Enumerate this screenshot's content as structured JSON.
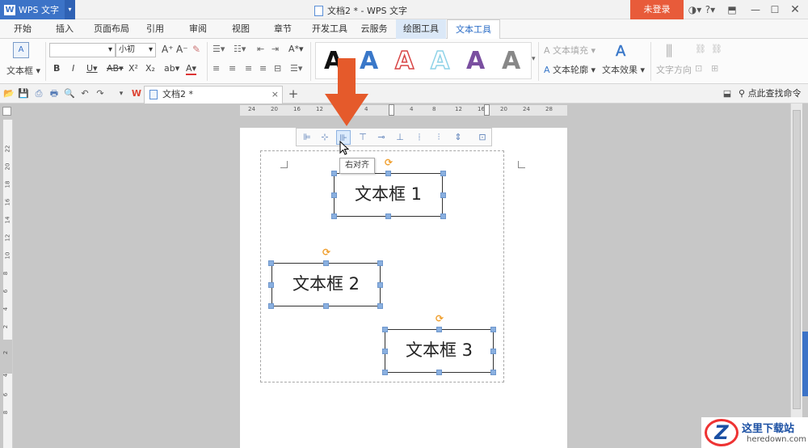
{
  "app": {
    "name": "WPS 文字",
    "window_title": "文档2 * - WPS 文字",
    "login": "未登录"
  },
  "titlebar_icons": [
    "minimize-icon",
    "maximize-icon",
    "close-icon"
  ],
  "tabs": [
    "开始",
    "插入",
    "页面布局",
    "引用",
    "审阅",
    "视图",
    "章节",
    "开发工具",
    "云服务",
    "绘图工具",
    "文本工具"
  ],
  "active_tab": "文本工具",
  "ribbon": {
    "textbox_label": "文本框",
    "font_size": "小初",
    "text_fill": "文本填充",
    "text_outline": "文本轮廓",
    "text_effect": "文本效果",
    "text_direction": "文字方向",
    "styles": [
      "A",
      "A",
      "A",
      "A",
      "A",
      "A"
    ],
    "style_colors": [
      "#111111",
      "#3a78c9",
      "#d84545",
      "#8fd3e8",
      "#7a4fa0",
      "#888888"
    ]
  },
  "doc_tab": {
    "title": "文档2 *",
    "close": "×",
    "add": "+"
  },
  "search_command": "点此查找命令",
  "hruler_ticks": [
    "24",
    "20",
    "16",
    "12",
    "8",
    "4",
    "",
    "4",
    "8",
    "12",
    "16",
    "20",
    "24",
    "28"
  ],
  "vruler_ticks": [
    "22",
    "20",
    "18",
    "16",
    "14",
    "12",
    "10",
    "8",
    "6",
    "4",
    "2",
    "",
    "2",
    "4",
    "6",
    "8"
  ],
  "tooltip": "右对齐",
  "textboxes": [
    "文本框 1",
    "文本框 2",
    "文本框 3"
  ],
  "watermark": {
    "title": "这里下载站",
    "url": "heredown.com"
  },
  "colors": {
    "accent": "#3c73c7",
    "login_bg": "#e85b3a",
    "arrow": "#e55a2b",
    "handle": "#8ab0e0"
  }
}
